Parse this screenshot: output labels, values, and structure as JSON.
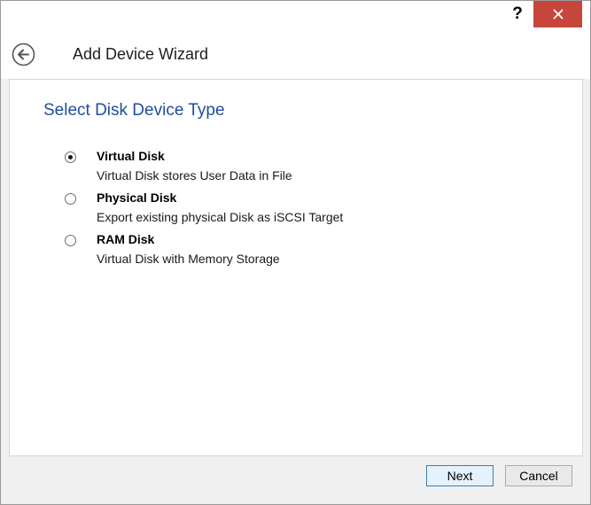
{
  "titlebar": {
    "help_label": "?",
    "close_icon": "close-icon",
    "close_color": "#c7463b"
  },
  "header": {
    "back_icon": "back-arrow-icon",
    "title": "Add Device Wizard"
  },
  "main": {
    "section_title": "Select Disk Device Type",
    "options": [
      {
        "label": "Virtual Disk",
        "description": "Virtual Disk stores User Data in File",
        "selected": true
      },
      {
        "label": "Physical Disk",
        "description": "Export existing physical Disk as iSCSI Target",
        "selected": false
      },
      {
        "label": "RAM Disk",
        "description": "Virtual Disk with Memory Storage",
        "selected": false
      }
    ]
  },
  "footer": {
    "next_label": "Next",
    "cancel_label": "Cancel"
  }
}
